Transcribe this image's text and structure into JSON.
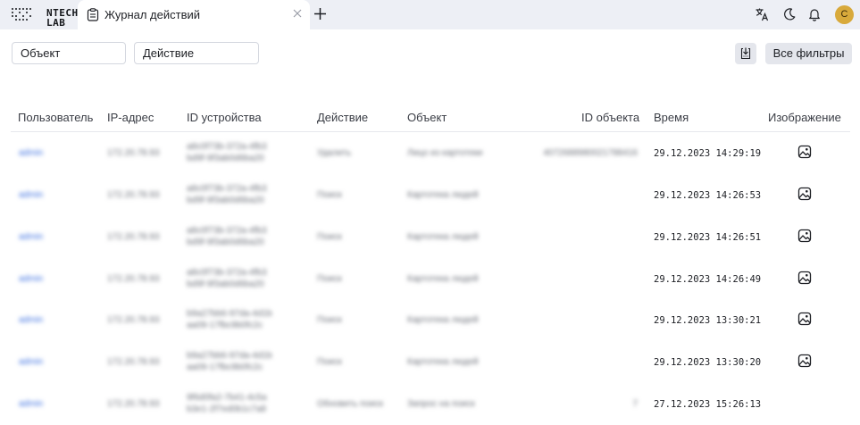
{
  "brand": {
    "logo_line1": "NTECH",
    "logo_line2": "LAB"
  },
  "tab": {
    "title": "Журнал действий"
  },
  "avatar": {
    "initial": "C",
    "color": "#d8a93b"
  },
  "filters": {
    "object": "Объект",
    "action": "Действие",
    "all_filters": "Все фильтры"
  },
  "table": {
    "headers": {
      "user": "Пользователь",
      "ip": "IP-адрес",
      "device": "ID устройства",
      "action": "Действие",
      "object": "Объект",
      "object_id": "ID объекта",
      "time": "Время",
      "image": "Изображение"
    },
    "rows": [
      {
        "user": "admin",
        "ip": "172.20.78.93",
        "device1": "a8c0f73b-372a-4fb3",
        "device2": "bd9f-9f3ab0d6ba20",
        "action": "Удалить",
        "object": "Лицо из картотеки",
        "object_id": "4072688980021788416",
        "time": "29.12.2023 14:29:19",
        "has_image": true
      },
      {
        "user": "admin",
        "ip": "172.20.78.93",
        "device1": "a8c0f73b-372a-4fb3",
        "device2": "bd9f-9f3ab0d6ba20",
        "action": "Поиск",
        "object": "Картотека людей",
        "object_id": "",
        "time": "29.12.2023 14:26:53",
        "has_image": true
      },
      {
        "user": "admin",
        "ip": "172.20.78.93",
        "device1": "a8c0f73b-372a-4fb3",
        "device2": "bd9f-9f3ab0d6ba20",
        "action": "Поиск",
        "object": "Картотека людей",
        "object_id": "",
        "time": "29.12.2023 14:26:51",
        "has_image": true
      },
      {
        "user": "admin",
        "ip": "172.20.78.93",
        "device1": "a8c0f73b-372a-4fb3",
        "device2": "bd9f-9f3ab0d6ba20",
        "action": "Поиск",
        "object": "Картотека людей",
        "object_id": "",
        "time": "29.12.2023 14:26:49",
        "has_image": true
      },
      {
        "user": "admin",
        "ip": "172.20.78.93",
        "device1": "b9a27bb6-97da-4d1b",
        "device2": "aa09-17fbc9b0fc2c",
        "action": "Поиск",
        "object": "Картотека людей",
        "object_id": "",
        "time": "29.12.2023 13:30:21",
        "has_image": true
      },
      {
        "user": "admin",
        "ip": "172.20.78.93",
        "device1": "b9a27bb6-97da-4d1b",
        "device2": "aa09-17fbc9b0fc2c",
        "action": "Поиск",
        "object": "Картотека людей",
        "object_id": "",
        "time": "29.12.2023 13:30:20",
        "has_image": true
      },
      {
        "user": "admin",
        "ip": "172.20.78.93",
        "device1": "9f6d0fa2-7b41-4c5a",
        "device2": "b3e1-2f7ed0b1c7a8",
        "action": "Обновить поиск",
        "object": "Запрос на поиск",
        "object_id": "7",
        "time": "27.12.2023 15:26:13",
        "has_image": false
      }
    ]
  },
  "icons": [
    "logo-dots-icon",
    "clipboard-icon",
    "close-icon",
    "plus-icon",
    "translate-icon",
    "moon-icon",
    "bell-icon",
    "download-icon",
    "image-icon"
  ]
}
